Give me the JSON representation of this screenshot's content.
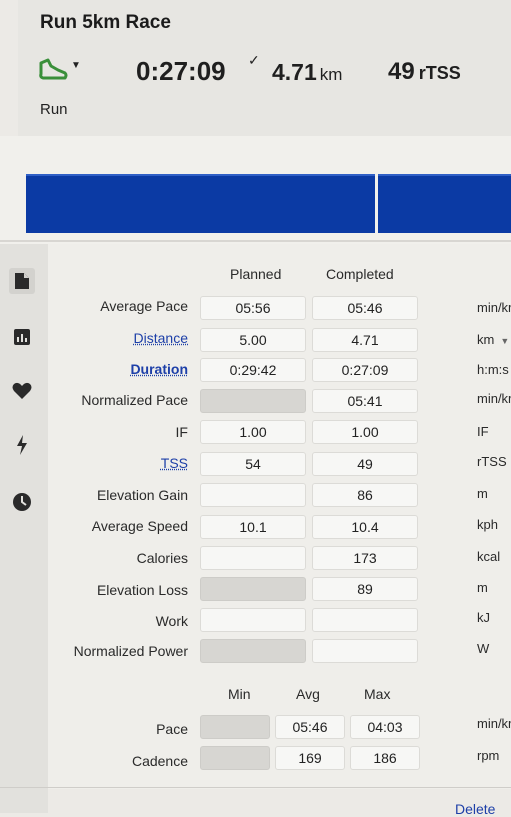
{
  "header": {
    "title": "Run 5km Race",
    "duration": "0:27:09",
    "check": "✓",
    "distance": "4.71",
    "distance_unit": "km",
    "tss": "49",
    "tss_unit": "rTSS",
    "sport": "Run"
  },
  "sidebar": {
    "icons": [
      "document-icon",
      "chart-icon",
      "heart-icon",
      "lightning-icon",
      "clock-icon"
    ]
  },
  "table": {
    "planned_header": "Planned",
    "completed_header": "Completed",
    "rows": [
      {
        "label": "Average Pace",
        "planned": "05:56",
        "completed": "05:46",
        "unit": "min/km"
      },
      {
        "label": "Distance",
        "planned": "5.00",
        "completed": "4.71",
        "unit": "km"
      },
      {
        "label": "Duration",
        "planned": "0:29:42",
        "completed": "0:27:09",
        "unit": "h:m:s"
      },
      {
        "label": "Normalized Pace",
        "planned": "",
        "completed": "05:41",
        "unit": "min/km"
      },
      {
        "label": "IF",
        "planned": "1.00",
        "completed": "1.00",
        "unit": "IF"
      },
      {
        "label": "TSS",
        "planned": "54",
        "completed": "49",
        "unit": "rTSS"
      },
      {
        "label": "Elevation Gain",
        "planned": "",
        "completed": "86",
        "unit": "m"
      },
      {
        "label": "Average Speed",
        "planned": "10.1",
        "completed": "10.4",
        "unit": "kph"
      },
      {
        "label": "Calories",
        "planned": "",
        "completed": "173",
        "unit": "kcal"
      },
      {
        "label": "Elevation Loss",
        "planned": "",
        "completed": "89",
        "unit": "m"
      },
      {
        "label": "Work",
        "planned": "",
        "completed": "",
        "unit": "kJ"
      },
      {
        "label": "Normalized Power",
        "planned": "",
        "completed": "",
        "unit": "W"
      }
    ]
  },
  "mma": {
    "min_header": "Min",
    "avg_header": "Avg",
    "max_header": "Max",
    "rows": [
      {
        "label": "Pace",
        "min": "",
        "avg": "05:46",
        "max": "04:03",
        "unit": "min/km"
      },
      {
        "label": "Cadence",
        "min": "",
        "avg": "169",
        "max": "186",
        "unit": "rpm"
      }
    ]
  },
  "footer": {
    "delete_label": "Delete"
  },
  "colors": {
    "bar": "#0b3aa4",
    "link": "#1d3fa8",
    "sport_icon": "#3a8f3a"
  }
}
